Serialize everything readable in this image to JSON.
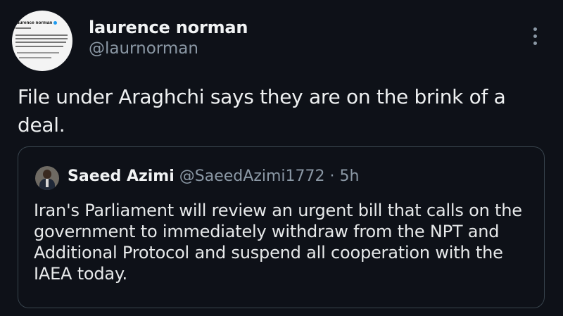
{
  "tweet": {
    "author_name": "laurence norman",
    "author_handle": "@laurnorman",
    "text": "File under Araghchi says they are on the brink of a deal.",
    "avatar_mini_name": "laurence norman"
  },
  "quoted": {
    "author_name": "Saeed Azimi",
    "author_handle": "@SaeedAzimi1772",
    "separator": "·",
    "time": "5h",
    "text": "Iran's Parliament will review an urgent bill that calls on the government to immediately withdraw from the NPT and Additional Protocol and suspend all cooperation with the IAEA today."
  },
  "icons": {
    "more": "more-vertical-icon",
    "verified": "verified-badge-icon"
  },
  "colors": {
    "background": "#0e1118",
    "text_primary": "#e7e9ea",
    "text_secondary": "#8b98a5",
    "border": "#38444d"
  }
}
